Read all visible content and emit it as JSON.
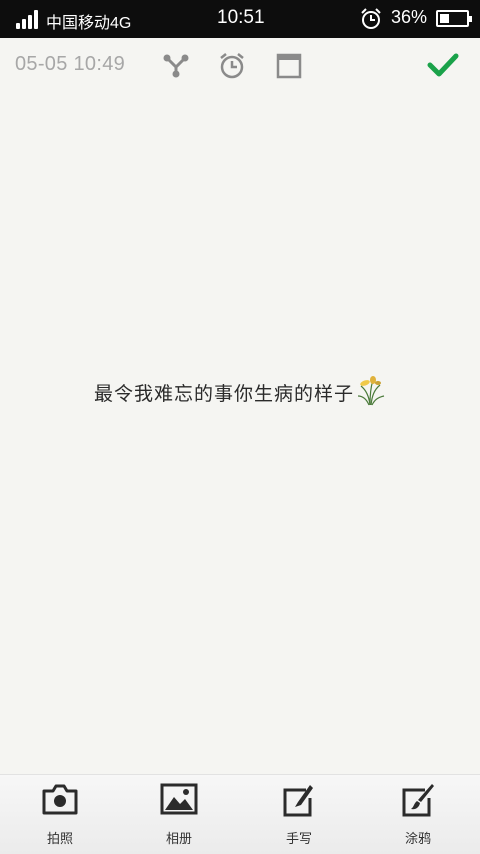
{
  "status_bar": {
    "carrier": "中国移动4G",
    "time": "10:51",
    "battery_percent": "36%",
    "battery_level": 0.36,
    "icons": [
      "signal-icon",
      "alarm-icon",
      "battery-icon"
    ]
  },
  "toolbar": {
    "timestamp": "05-05 10:49",
    "icons": [
      "share-icon",
      "alarm-icon",
      "frame-icon",
      "checkmark-icon"
    ],
    "accent_color": "#1aa24a"
  },
  "note": {
    "text": "最令我难忘的事你生病的样子",
    "emoji": "plant-icon"
  },
  "bottom_bar": {
    "items": [
      {
        "label": "拍照",
        "icon": "camera-icon"
      },
      {
        "label": "相册",
        "icon": "gallery-icon"
      },
      {
        "label": "手写",
        "icon": "handwrite-icon"
      },
      {
        "label": "涂鸦",
        "icon": "doodle-icon"
      }
    ]
  }
}
